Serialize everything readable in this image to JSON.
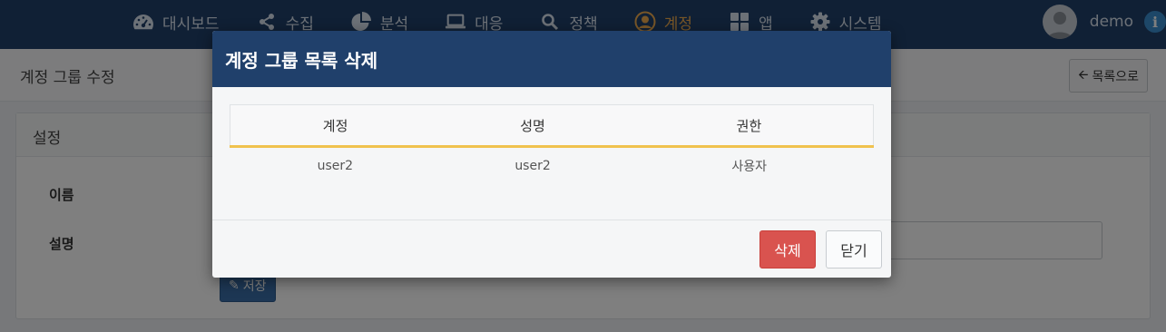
{
  "nav": {
    "items": [
      {
        "label": "대시보드",
        "icon": "dashboard-icon"
      },
      {
        "label": "수집",
        "icon": "share-icon"
      },
      {
        "label": "분석",
        "icon": "pie-chart-icon"
      },
      {
        "label": "대응",
        "icon": "laptop-icon"
      },
      {
        "label": "정책",
        "icon": "search-icon"
      },
      {
        "label": "계정",
        "icon": "user-circle-icon",
        "active": true
      },
      {
        "label": "앱",
        "icon": "grid-icon"
      },
      {
        "label": "시스템",
        "icon": "gear-icon"
      }
    ],
    "user_name": "demo",
    "info_glyph": "i",
    "colors": {
      "bar": "#20406b",
      "active": "#f0ad4e"
    }
  },
  "page": {
    "title": "계정 그룹 수정",
    "back_label": "목록으로",
    "panel_title": "설정",
    "name_label": "이름",
    "desc_label": "설명",
    "save_label": "저장"
  },
  "modal": {
    "title": "계정 그룹 목록 삭제",
    "columns": [
      "계정",
      "성명",
      "권한"
    ],
    "rows": [
      [
        "user2",
        "user2",
        "사용자"
      ]
    ],
    "delete_label": "삭제",
    "close_label": "닫기",
    "colors": {
      "header": "#20406b",
      "delete": "#d9534f",
      "header_rule": "#f0c24e"
    }
  }
}
